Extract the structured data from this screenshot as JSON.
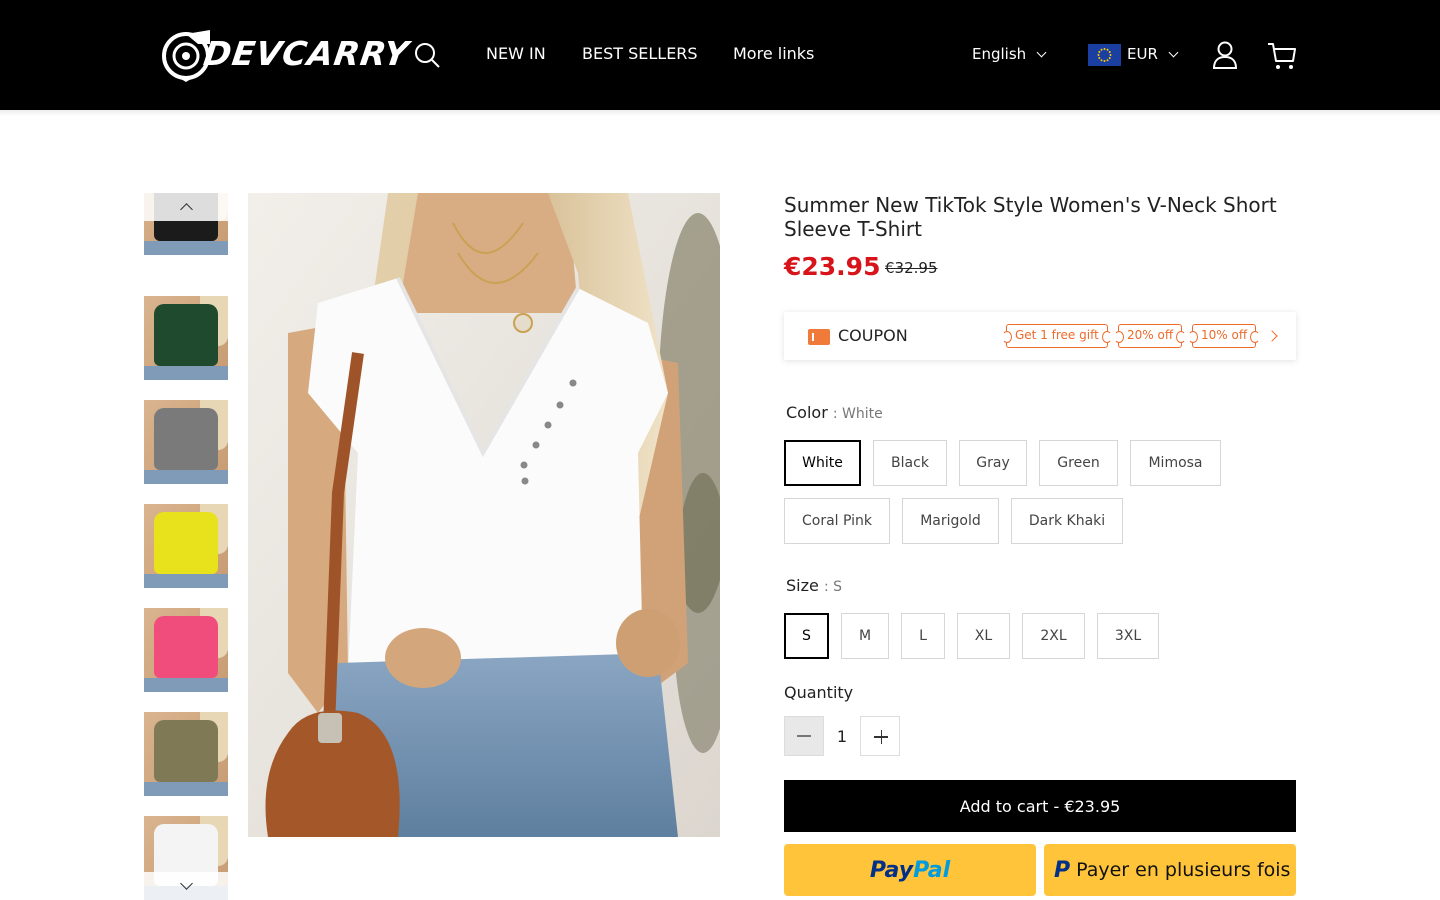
{
  "header": {
    "logo_text": "DEVCARRY",
    "nav": [
      "NEW IN",
      "BEST SELLERS",
      "More links"
    ],
    "language": "English",
    "currency": "EUR",
    "icons": [
      "search-icon",
      "user-icon",
      "cart-icon",
      "eu-flag-icon"
    ]
  },
  "gallery": {
    "thumbnails": [
      {
        "color": "#1b1b1b"
      },
      {
        "color": "#1f4a2e"
      },
      {
        "color": "#7a7a7a"
      },
      {
        "color": "#e8e21c"
      },
      {
        "color": "#f14d7c"
      },
      {
        "color": "#7f7a55"
      },
      {
        "color": "#f4f4f4"
      }
    ],
    "active_index": 6
  },
  "product": {
    "title": "Summer New TikTok Style Women's V-Neck Short Sleeve T-Shirt",
    "price": "€23.95",
    "old_price": "€32.95",
    "price_color": "#d7141a"
  },
  "coupon": {
    "label": "COUPON",
    "tags": [
      "Get 1 free gift",
      "20% off",
      "10% off"
    ]
  },
  "color_option": {
    "label": "Color",
    "selected_text": ": White",
    "options": [
      "White",
      "Black",
      "Gray",
      "Green",
      "Mimosa",
      "Coral Pink",
      "Marigold",
      "Dark Khaki"
    ],
    "selected": "White"
  },
  "size_option": {
    "label": "Size",
    "selected_text": ": S",
    "options": [
      "S",
      "M",
      "L",
      "XL",
      "2XL",
      "3XL"
    ],
    "selected": "S"
  },
  "quantity": {
    "label": "Quantity",
    "value": "1"
  },
  "actions": {
    "add_to_cart": "Add to cart - €23.95",
    "paypal_1": "Pay",
    "paypal_2": "Pal",
    "paylater": "Payer en plusieurs fois",
    "paylater_mark": "P"
  }
}
